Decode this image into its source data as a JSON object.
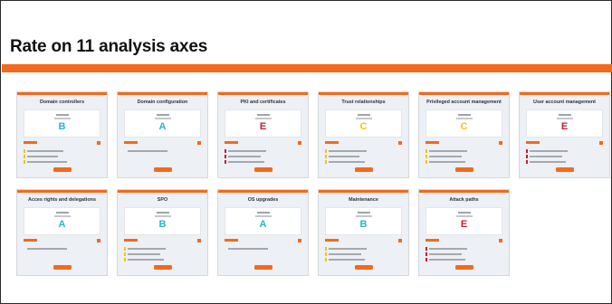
{
  "page": {
    "title": "Rate on 11 analysis axes"
  },
  "colors": {
    "accent": "#f26a1b",
    "grade_A": "#28b5c9",
    "grade_B": "#28b5c9",
    "grade_C": "#f2c318",
    "grade_E": "#c11c35"
  },
  "cards": [
    {
      "title": "Domain controllers",
      "grade": "B",
      "findings": [
        {
          "sev": "C",
          "len": 40
        },
        {
          "sev": "C",
          "len": 34
        },
        {
          "sev": "C",
          "len": 44
        }
      ]
    },
    {
      "title": "Domain configuration",
      "grade": "A",
      "findings": [
        {
          "sev": "none",
          "len": 44
        }
      ]
    },
    {
      "title": "PKI and certificates",
      "grade": "E",
      "findings": [
        {
          "sev": "E",
          "len": 42
        },
        {
          "sev": "E",
          "len": 36
        },
        {
          "sev": "E",
          "len": 40
        }
      ]
    },
    {
      "title": "Trust relationships",
      "grade": "C",
      "findings": [
        {
          "sev": "C",
          "len": 42
        },
        {
          "sev": "C",
          "len": 34
        },
        {
          "sev": "C",
          "len": 40
        }
      ]
    },
    {
      "title": "Privileged account management",
      "grade": "C",
      "findings": [
        {
          "sev": "C",
          "len": 42
        },
        {
          "sev": "C",
          "len": 36
        },
        {
          "sev": "C",
          "len": 40
        }
      ]
    },
    {
      "title": "User account management",
      "grade": "E",
      "findings": [
        {
          "sev": "E",
          "len": 42
        },
        {
          "sev": "E",
          "len": 36
        },
        {
          "sev": "E",
          "len": 40
        }
      ]
    },
    {
      "title": "Acces rights and delegations",
      "grade": "A",
      "findings": [
        {
          "sev": "none",
          "len": 44
        }
      ]
    },
    {
      "title": "SPO",
      "grade": "B",
      "findings": [
        {
          "sev": "C",
          "len": 42
        },
        {
          "sev": "C",
          "len": 36
        },
        {
          "sev": "C",
          "len": 40
        }
      ]
    },
    {
      "title": "OS upgrades",
      "grade": "A",
      "findings": [
        {
          "sev": "none",
          "len": 44
        }
      ]
    },
    {
      "title": "Maintenance",
      "grade": "B",
      "findings": [
        {
          "sev": "C",
          "len": 42
        },
        {
          "sev": "C",
          "len": 36
        },
        {
          "sev": "C",
          "len": 40
        }
      ]
    },
    {
      "title": "Attack paths",
      "grade": "E",
      "findings": [
        {
          "sev": "E",
          "len": 42
        },
        {
          "sev": "E",
          "len": 36
        },
        {
          "sev": "E",
          "len": 40
        }
      ]
    }
  ]
}
